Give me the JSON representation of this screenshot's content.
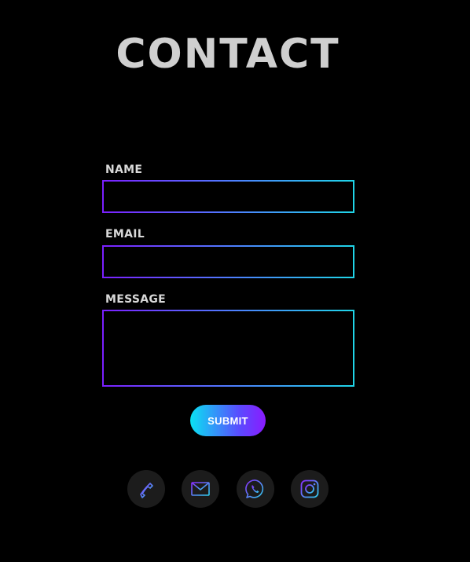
{
  "page": {
    "title": "CONTACT"
  },
  "form": {
    "name": {
      "label": "NAME",
      "value": "",
      "placeholder": ""
    },
    "email": {
      "label": "EMAIL",
      "value": "",
      "placeholder": ""
    },
    "message": {
      "label": "MESSAGE",
      "value": "",
      "placeholder": ""
    },
    "submit_label": "SUBMIT"
  },
  "social": [
    {
      "icon": "phone-icon"
    },
    {
      "icon": "email-icon"
    },
    {
      "icon": "whatsapp-icon"
    },
    {
      "icon": "instagram-icon"
    }
  ],
  "colors": {
    "background": "#000000",
    "title": "#cfcfcf",
    "gradient_start": "#7b1fff",
    "gradient_end": "#1fd6e8",
    "social_bg": "#1c1c1c"
  }
}
